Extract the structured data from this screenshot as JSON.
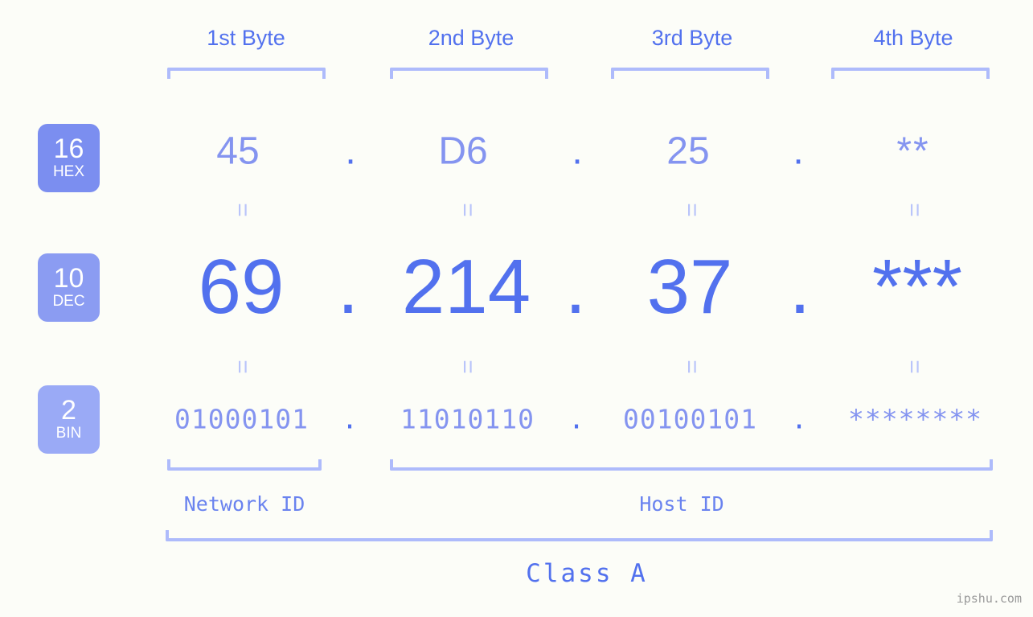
{
  "background_color": "#fcfdf8",
  "accent_color": "#5271ee",
  "accent_light": "#8494f0",
  "bracket_color": "#aebbfb",
  "byte_headers": [
    {
      "label": "1st Byte"
    },
    {
      "label": "2nd Byte"
    },
    {
      "label": "3rd Byte"
    },
    {
      "label": "4th Byte"
    }
  ],
  "bases": [
    {
      "num": "16",
      "name": "HEX",
      "color": "#7b8ef0"
    },
    {
      "num": "10",
      "name": "DEC",
      "color": "#8b9cf2"
    },
    {
      "num": "2",
      "name": "BIN",
      "color": "#9aaaf6"
    }
  ],
  "rows": {
    "hex": {
      "values": [
        "45",
        "D6",
        "25",
        "**"
      ],
      "separator": "."
    },
    "dec": {
      "values": [
        "69",
        "214",
        "37",
        "***"
      ],
      "separator": "."
    },
    "bin": {
      "values": [
        "01000101",
        "11010110",
        "00100101",
        "********"
      ],
      "separator": "."
    }
  },
  "equals_glyph": "=",
  "segments": {
    "network_id": "Network ID",
    "host_id": "Host ID",
    "class": "Class A"
  },
  "watermark": "ipshu.com"
}
